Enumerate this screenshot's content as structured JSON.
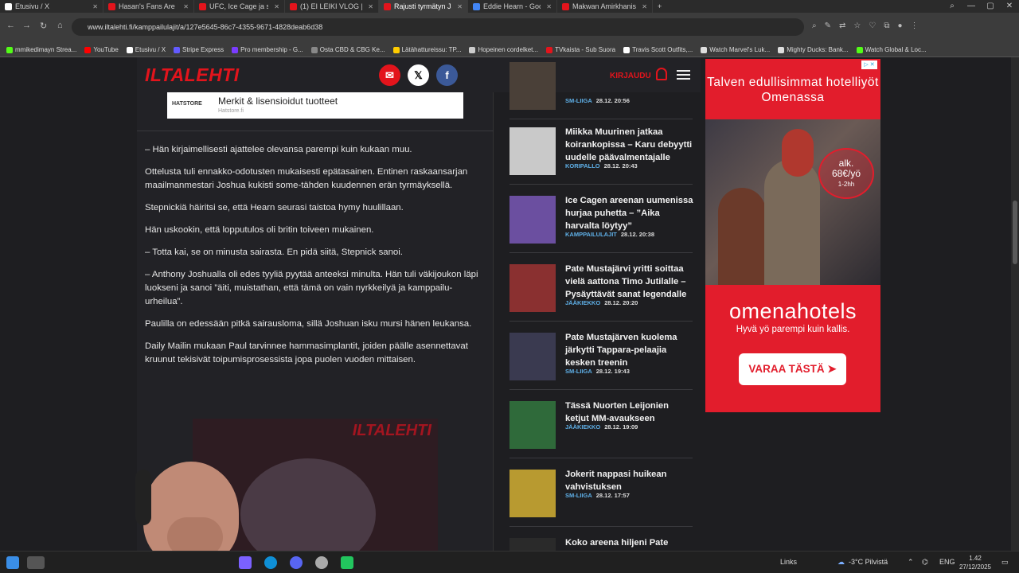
{
  "browser": {
    "tabs": [
      {
        "label": "Etusivu / X",
        "color": "#ffffff",
        "active": false
      },
      {
        "label": "Hasan's Fans Are F**king",
        "color": "#e3141c",
        "active": false
      },
      {
        "label": "UFC, Ice Cage ja sparrarit",
        "color": "#e3141c",
        "active": false
      },
      {
        "label": "(1) EI LEIKI VLOG | PIKKU",
        "color": "#e3141c",
        "active": false
      },
      {
        "label": "Rajusti tyrmätyn Jake Paul",
        "color": "#e3141c",
        "active": true
      },
      {
        "label": "Eddie Hearn - Google-hak",
        "color": "#4285f4",
        "active": false
      },
      {
        "label": "Makwan Amirkhanista kuu",
        "color": "#e3141c",
        "active": false
      }
    ],
    "new_tab_label": "+",
    "url": "www.iltalehti.fi/kamppailulajit/a/127e5645-86c7-4355-9671-4828deab6d38",
    "bookmarks": [
      {
        "label": "mmikedimayn Strea...",
        "color": "#53fc18"
      },
      {
        "label": "YouTube",
        "color": "#ff0000"
      },
      {
        "label": "Etusivu / X",
        "color": "#ffffff"
      },
      {
        "label": "Stripe Express",
        "color": "#635bff"
      },
      {
        "label": "Pro membership - G...",
        "color": "#7a3cff"
      },
      {
        "label": "Osta CBD & CBG Ke...",
        "color": "#888888"
      },
      {
        "label": "Lätähattureissu: TP...",
        "color": "#ffcc00"
      },
      {
        "label": "Hopeinen cordelket...",
        "color": "#cccccc"
      },
      {
        "label": "TVkaista - Sub Suora",
        "color": "#e3141c"
      },
      {
        "label": "Travis Scott Outfits,...",
        "color": "#ffffff"
      },
      {
        "label": "Watch Marvel's Luk...",
        "color": "#dddddd"
      },
      {
        "label": "Mighty Ducks: Bank...",
        "color": "#dddddd"
      },
      {
        "label": "Watch Global & Loc...",
        "color": "#53fc18"
      }
    ]
  },
  "header": {
    "logo": "ILTALEHTI",
    "login": "KIRJAUDU"
  },
  "ad_banner": {
    "brand": "HATSTORE",
    "title": "Merkit & lisensioidut tuotteet",
    "domain": "Hatstore.fi"
  },
  "article": {
    "paragraphs": [
      "– Hän kirjaimellisesti ajattelee olevansa parempi kuin kukaan muu.",
      "Ottelusta tuli ennakko-odotusten mukaisesti epätasainen. Entinen raskaansarjan maailmanmestari Joshua kukisti some-tähden kuudennen erän tyrmäyksellä.",
      "Stepnickiä häiritsi se, että Hearn seurasi taistoa hymy huulillaan.",
      "Hän uskookin, että lopputulos oli britin toiveen mukainen.",
      "– Totta kai, se on minusta sairasta. En pidä siitä, Stepnick sanoi.",
      "– Anthony Joshualla oli edes tyyliä pyytää anteeksi minulta. Hän tuli väkijoukon läpi luokseni ja sanoi ”äiti, muistathan, että tämä on vain nyrkkeilyä ja kamppailu-urheilua”.",
      "Paulilla on edessään pitkä sairausloma, sillä Joshuan isku mursi hänen leukansa.",
      "Daily Mailin mukaan Paul tarvinnee hammasimplantit, joiden päälle asennettavat kruunut tekisivät toipumisprosessista jopa puolen vuoden mittaisen."
    ],
    "video_logo": "ILTALEHTI"
  },
  "sidebar": {
    "items": [
      {
        "title": "",
        "category": "SM-LIIGA",
        "time": "28.12. 20:56",
        "thumb": "#4a4038"
      },
      {
        "title": "Miikka Muurinen jatkaa koirankopissa – Karu debyytti uudelle päävalmentajalle",
        "category": "KORIPALLO",
        "time": "28.12. 20:43",
        "thumb": "#c9c9c9"
      },
      {
        "title": "Ice Cagen areenan uumenissa hurjaa puhetta – ”Aika harvalta löytyy”",
        "category": "KAMPPAILULAJIT",
        "time": "28.12. 20:38",
        "thumb": "#6b4fa0"
      },
      {
        "title": "Pate Mustajärvi yritti soittaa vielä aattona Timo Jutilalle – Pysäyttävät sanat legendalle",
        "category": "JÄÄKIEKKO",
        "time": "28.12. 20:20",
        "thumb": "#8a3030"
      },
      {
        "title": "Pate Mustajärven kuolema järkytti Tappara-pelaajia kesken treenin",
        "category": "SM-LIIGA",
        "time": "28.12. 19:43",
        "thumb": "#3a3a50"
      },
      {
        "title": "Tässä Nuorten Leijonien ketjut MM-avaukseen",
        "category": "JÄÄKIEKKO",
        "time": "28.12. 19:09",
        "thumb": "#2f6a3a"
      },
      {
        "title": "Jokerit nappasi huikean vahvistuksen",
        "category": "SM-LIIGA",
        "time": "28.12. 17:57",
        "thumb": "#b89a30"
      },
      {
        "title": "Koko areena hiljeni Pate Mustajärven muistolle",
        "category": "",
        "time": "",
        "thumb": "#2a2a2a"
      }
    ]
  },
  "hotel_ad": {
    "headline": "Talven edullisimmat hotelliyöt Omenassa",
    "price_from": "alk.",
    "price": "68€/yö",
    "duration": "1-2hh",
    "brand": "omenahotels",
    "tagline": "Hyvä yö parempi kuin kallis.",
    "cta": "VARAA TÄSTÄ ➤",
    "adchoice": "▷ ✕"
  },
  "taskbar": {
    "links_label": "Links",
    "weather": "-3°C Pilvistä",
    "language": "ENG",
    "time": "1.42",
    "date": "27/12/2025"
  }
}
